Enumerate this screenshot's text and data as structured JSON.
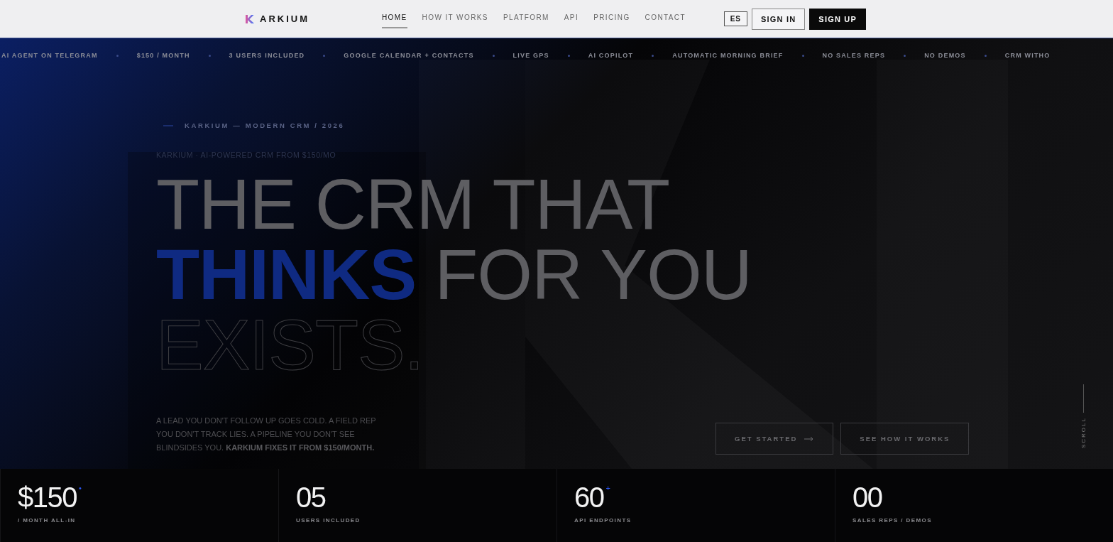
{
  "nav": {
    "logo": "ARKIUM",
    "links": [
      {
        "label": "HOME",
        "selected": true
      },
      {
        "label": "HOW IT WORKS",
        "selected": false
      },
      {
        "label": "PLATFORM",
        "selected": false
      },
      {
        "label": "API",
        "selected": false
      },
      {
        "label": "PRICING",
        "selected": false
      },
      {
        "label": "CONTACT",
        "selected": false
      }
    ],
    "language": "ES",
    "sign_in": "SIGN IN",
    "sign_up": "SIGN UP"
  },
  "ticker": [
    "AI AGENT ON TELEGRAM",
    "$150 / MONTH",
    "3 USERS INCLUDED",
    "GOOGLE CALENDAR + CONTACTS",
    "LIVE GPS",
    "AI COPILOT",
    "AUTOMATIC MORNING BRIEF",
    "NO SALES REPS",
    "NO DEMOS",
    "CRM WITHO"
  ],
  "hero": {
    "eyebrow": "KARKIUM — MODERN CRM / 2026",
    "subtitle": "KARKIUM · AI-POWERED CRM FROM $150/MO",
    "headline": [
      [
        {
          "text": "THE CRM THAT",
          "kind": "plain"
        }
      ],
      [
        {
          "text": "THINKS",
          "kind": "accent"
        },
        {
          "text": "FOR YOU",
          "kind": "plain"
        }
      ],
      [
        {
          "text": "EXISTS.",
          "kind": "outline"
        }
      ]
    ],
    "body": "A LEAD YOU DON'T FOLLOW UP GOES COLD. A FIELD REP YOU DON'T TRACK LIES. A PIPELINE YOU DON'T SEE BLINDSIDES YOU. **KARKIUM FIXES IT FROM $150/MONTH.**",
    "buttons": [
      "GET STARTED",
      "SEE HOW IT WORKS"
    ],
    "scroll": "SCROLL"
  },
  "stats": [
    {
      "value": "$150",
      "mark": "•",
      "label": "/ MONTH ALL-IN"
    },
    {
      "value": "05",
      "label": "USERS INCLUDED"
    },
    {
      "value": "60",
      "mark": "+",
      "label": "API ENDPOINTS"
    },
    {
      "value": "00",
      "label": "SALES REPS / DEMOS"
    }
  ]
}
